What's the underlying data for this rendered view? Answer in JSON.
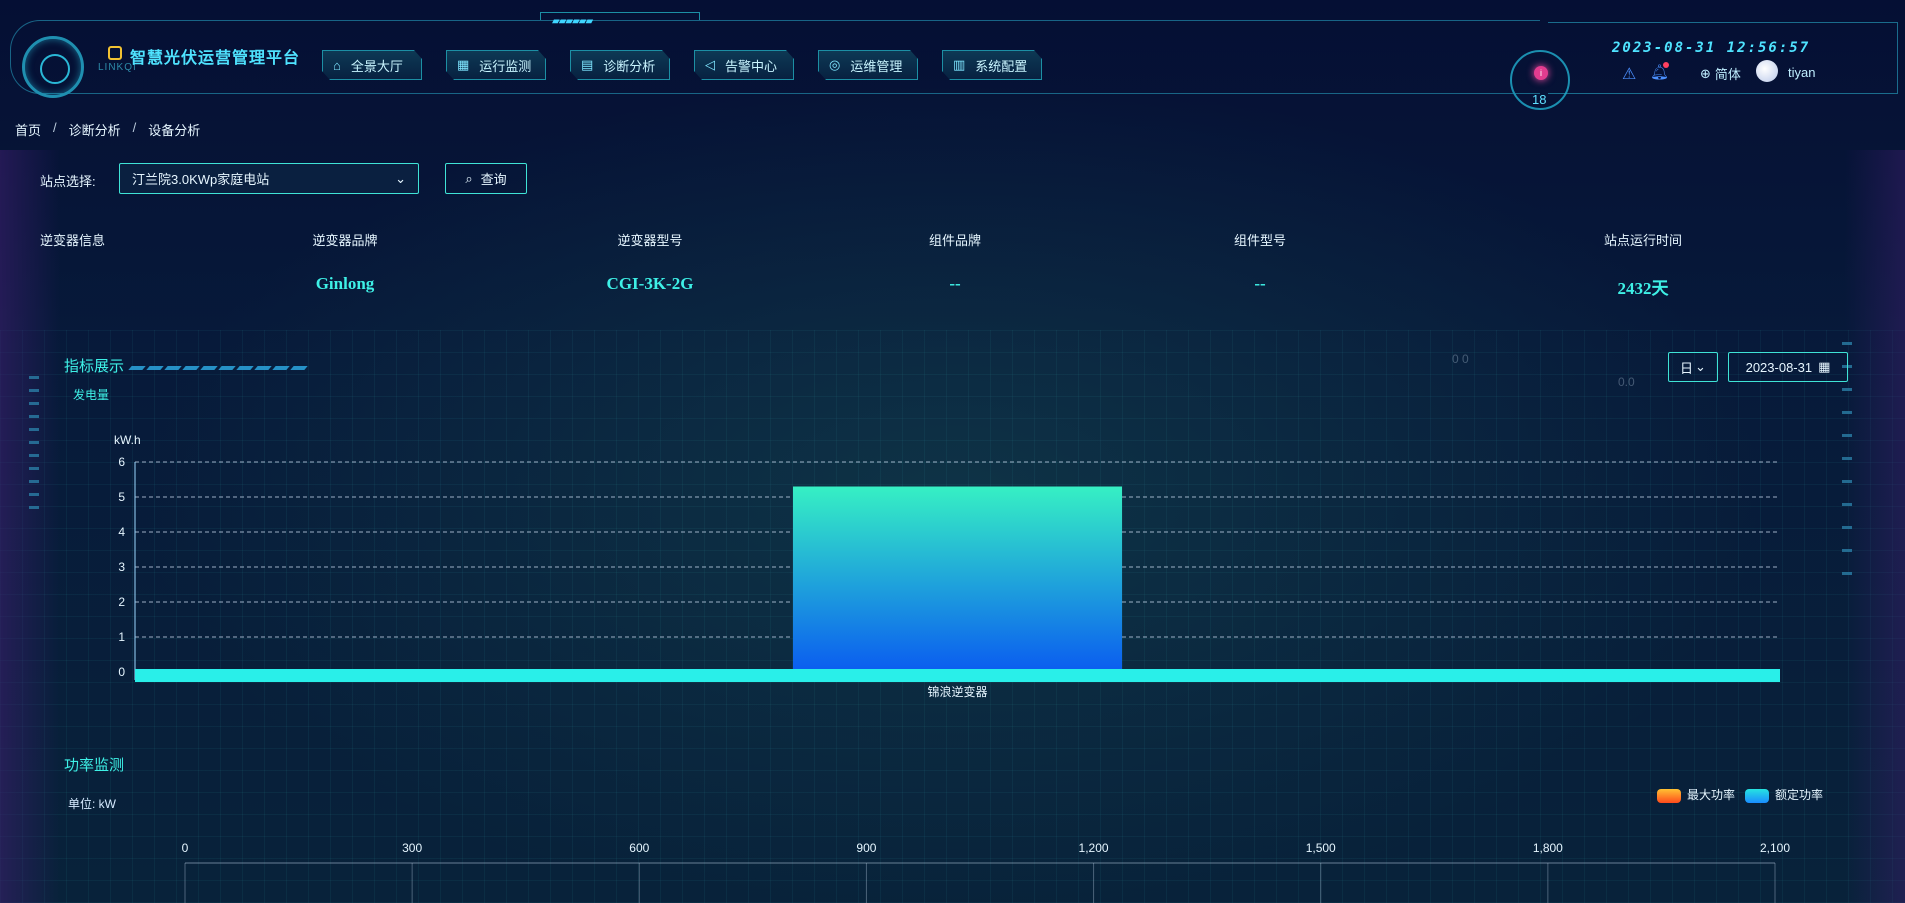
{
  "header": {
    "brand": "LINKQI",
    "title": "智慧光伏运营管理平台",
    "nav": [
      {
        "label": "全景大厅",
        "icon": "bank-icon"
      },
      {
        "label": "运行监测",
        "icon": "grid-icon"
      },
      {
        "label": "诊断分析",
        "icon": "document-icon"
      },
      {
        "label": "告警中心",
        "icon": "megaphone-icon"
      },
      {
        "label": "运维管理",
        "icon": "gear-icon"
      },
      {
        "label": "系统配置",
        "icon": "chart-icon"
      }
    ],
    "alarm_count": "18",
    "datetime": "2023-08-31 12:56:57",
    "language": "简体",
    "username": "tiyan"
  },
  "breadcrumb": [
    "首页",
    "诊断分析",
    "设备分析"
  ],
  "filter": {
    "label": "站点选择:",
    "station": "汀兰院3.0KWp家庭电站",
    "query_label": "查询"
  },
  "info": {
    "section_label": "逆变器信息",
    "fields": [
      {
        "label": "逆变器品牌",
        "value": "Ginlong"
      },
      {
        "label": "逆变器型号",
        "value": "CGI-3K-2G"
      },
      {
        "label": "组件品牌",
        "value": "--"
      },
      {
        "label": "组件型号",
        "value": "--"
      },
      {
        "label": "站点运行时间",
        "value": "2432天"
      }
    ]
  },
  "indicator": {
    "title": "指标展示",
    "subtitle": "发电量",
    "period": "日",
    "date": "2023-08-31",
    "faint_a": "0 0",
    "faint_b": "0.0"
  },
  "power": {
    "title": "功率监测",
    "unit": "单位: kW",
    "legend": [
      {
        "name": "最大功率",
        "from": "#ff4a1c",
        "to": "#ffc233"
      },
      {
        "name": "额定功率",
        "from": "#1a8cff",
        "to": "#26e3e0"
      }
    ],
    "axis_ticks": [
      "0",
      "300",
      "600",
      "900",
      "1,200",
      "1,500",
      "1,800",
      "2,100"
    ]
  },
  "chart_data": [
    {
      "type": "bar",
      "ylabel": "kW.h",
      "categories": [
        "锦浪逆变器"
      ],
      "values": [
        5.3
      ],
      "ylim": [
        0,
        6
      ],
      "yticks": [
        0,
        1,
        2,
        3,
        4,
        5,
        6
      ],
      "grid": true,
      "colors": {
        "top": "#36f0c4",
        "bottom": "#0a5cf0",
        "axis_bar": "#29efe9"
      }
    },
    {
      "type": "bar",
      "orientation": "horizontal",
      "xlim": [
        0,
        2100
      ],
      "xticks": [
        0,
        300,
        600,
        900,
        1200,
        1500,
        1800,
        2100
      ],
      "series": [
        {
          "name": "最大功率",
          "values": []
        },
        {
          "name": "额定功率",
          "values": []
        }
      ]
    }
  ]
}
